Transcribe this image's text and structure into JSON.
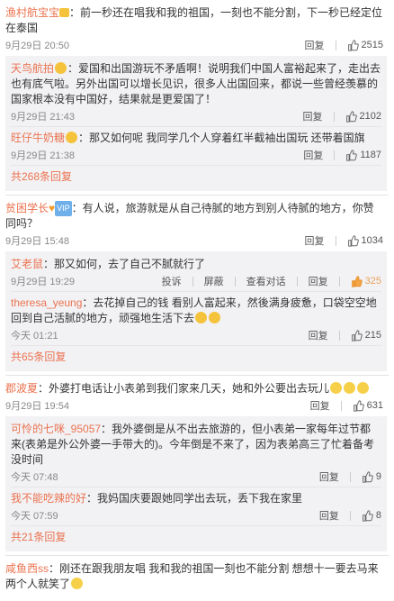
{
  "comments": [
    {
      "name": "渔村航宝宝",
      "text": "：前一秒还在唱我和我的祖国，一刻也不能分割，下一秒已经定位在泰国",
      "time": "9月29日 20:50",
      "reply_label": "回复",
      "likes": "2515",
      "replies": [
        {
          "name": "天鸟航拍",
          "text": "：爱国和出国游玩不矛盾啊！说明我们中国人富裕起来了，走出去也有底气啦。另外出国可以增长见识，很多人出国回来，都说一些曾经羡慕的国家根本没有中国好，结果就是更爱国了！",
          "time": "9月29日 21:43",
          "reply_label": "回复",
          "likes": "2102"
        },
        {
          "name": "旺仔牛奶糖",
          "text": "：那又如何呢 我同学几个人穿着红半截袖出国玩 还带着国旗",
          "time": "9月29日 21:38",
          "reply_label": "回复",
          "likes": "1187"
        }
      ],
      "more": "共268条回复"
    },
    {
      "name": "贫困学长",
      "text": "：有人说，旅游就是从自己待腻的地方到别人待腻的地方，你赞同吗？",
      "time": "9月29日 15:48",
      "reply_label": "回复",
      "likes": "1034",
      "replies": [
        {
          "name": "艾老鼠",
          "text": "：那又如何，去了自己不腻就行了",
          "time": "9月29日 19:29",
          "extra_actions": [
            "投诉",
            "屏蔽",
            "查看对话"
          ],
          "reply_label": "回复",
          "likes": "325"
        },
        {
          "name": "theresa_yeung",
          "text": "：去花掉自己的钱 看别人富起来，然後满身疲惫，口袋空空地回到自己活腻的地方，顽强地生活下去",
          "time": "今天 01:21",
          "reply_label": "回复",
          "likes": "215"
        }
      ],
      "more": "共65条回复"
    },
    {
      "name": "郡波夏",
      "text": "：外婆打电话让小表弟到我们家来几天，她和外公要出去玩儿",
      "time": "9月29日 19:54",
      "reply_label": "回复",
      "likes": "631",
      "replies": [
        {
          "name": "可怜的七咪_95057",
          "text": "：我外婆倒是从不出去旅游的，但小表弟一家每年过节都来(表弟是外公外婆一手带大的)。今年倒是不来了，因为表弟高三了忙着备考没时间",
          "time": "今天 07:48",
          "reply_label": "回复",
          "likes": "9"
        },
        {
          "name": "我不能吃辣的好",
          "text": "：我妈国庆要跟她同学出去玩，丢下我在家里",
          "time": "今天 07:59",
          "reply_label": "回复",
          "likes": "8"
        }
      ],
      "more": "共21条回复"
    },
    {
      "name": "咸鱼西ss",
      "text": "：刚还在跟我朋友唱 我和我的祖国一刻也不能分割 想想十一要去马来两个人就笑了"
    }
  ]
}
